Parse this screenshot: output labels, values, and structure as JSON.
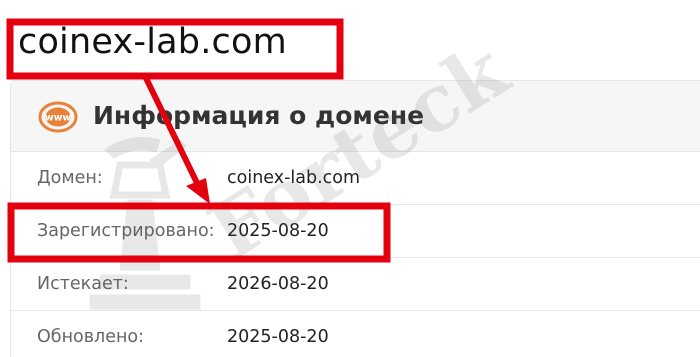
{
  "domain_title": "coinex-lab.com",
  "card": {
    "title": "Информация о домене",
    "icon": "www-icon",
    "rows": [
      {
        "label": "Домен:",
        "value": "coinex-lab.com"
      },
      {
        "label": "Зарегистрировано:",
        "value": "2025-08-20"
      },
      {
        "label": "Истекает:",
        "value": "2026-08-20"
      },
      {
        "label": "Обновлено:",
        "value": "2025-08-20"
      }
    ]
  },
  "watermark": {
    "text": "Forteck"
  },
  "colors": {
    "annotation": "#e3000f",
    "icon_orange": "#e8823a",
    "header_bg": "#f6f6f6",
    "border": "#e6e6e6"
  }
}
